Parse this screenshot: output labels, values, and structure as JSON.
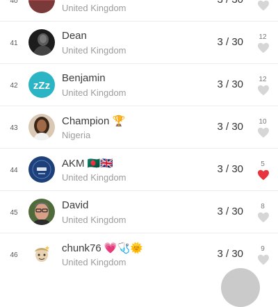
{
  "rows": [
    {
      "rank": "40",
      "name": "",
      "country": "United Kingdom",
      "score": "3 / 30",
      "likes": "",
      "liked": false
    },
    {
      "rank": "41",
      "name": "Dean",
      "country": "United Kingdom",
      "score": "3 / 30",
      "likes": "12",
      "liked": false
    },
    {
      "rank": "42",
      "name": "Benjamin",
      "country": "United Kingdom",
      "score": "3 / 30",
      "likes": "12",
      "liked": false
    },
    {
      "rank": "43",
      "name": "Champion 🏆",
      "country": "Nigeria",
      "score": "3 / 30",
      "likes": "10",
      "liked": false
    },
    {
      "rank": "44",
      "name": "AKM 🇧🇩🇬🇧",
      "country": "United Kingdom",
      "score": "3 / 30",
      "likes": "5",
      "liked": true
    },
    {
      "rank": "45",
      "name": "David",
      "country": "United Kingdom",
      "score": "3 / 30",
      "likes": "8",
      "liked": false
    },
    {
      "rank": "46",
      "name": "chunk76 💗🩺🌞",
      "country": "United Kingdom",
      "score": "3 / 30",
      "likes": "9",
      "liked": false
    }
  ],
  "colors": {
    "heart_empty": "#d6d6d6",
    "heart_filled": "#e8343f",
    "divider": "#ececec",
    "avatar_zzz": "#2bb5c4",
    "avatar_akm": "#1d3f7a"
  },
  "icons": {
    "heart": "heart-icon",
    "zzz_avatar": "zzz-icon"
  }
}
